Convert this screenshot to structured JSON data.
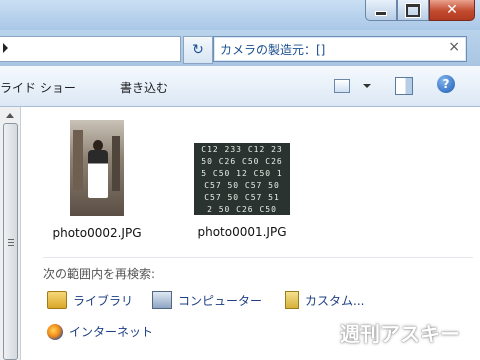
{
  "window": {
    "controls": {
      "minimize_icon": "minimize-icon",
      "maximize_icon": "maximize-icon",
      "close_icon": "close-icon",
      "close_glyph": "✕"
    }
  },
  "address": {
    "search_text": "カメラの製造元：[]",
    "clear_glyph": "×",
    "refresh_glyph": "↻"
  },
  "toolbar": {
    "slideshow_label": "ライド ショー",
    "burn_label": "書き込む",
    "help_glyph": "?"
  },
  "files": [
    {
      "name": "photo0002.JPG"
    },
    {
      "name": "photo0001.JPG"
    }
  ],
  "photo1_rows": [
    "C12 233 C12 23",
    "50 C26 C50 C26",
    "5 C50 12 C50 1",
    "C57 50 C57 50",
    "C57 50 C57 51",
    "2 50 C26 C50"
  ],
  "search_again": {
    "heading": "次の範囲内を再検索:",
    "locations": [
      {
        "label": "ライブラリ",
        "icon": "library-icon"
      },
      {
        "label": "コンピューター",
        "icon": "computer-icon"
      },
      {
        "label": "カスタム...",
        "icon": "custom-folder-icon"
      },
      {
        "label": "インターネット",
        "icon": "internet-icon"
      }
    ]
  },
  "watermark": "週刊アスキー",
  "colors": {
    "accent": "#1d3f85",
    "search_text": "#1a4f8f"
  }
}
